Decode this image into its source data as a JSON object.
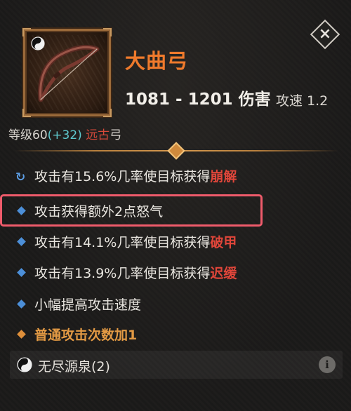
{
  "item": {
    "name": "大曲弓",
    "damage": "1081 - 1201 伤害",
    "speed": "攻速 1.2",
    "level_prefix": "等级60",
    "level_bonus": "(+32)",
    "level_type_colored": "远古",
    "level_type_suffix": "弓"
  },
  "close_label": "×",
  "attributes": [
    {
      "icon": "refresh-icon",
      "text": "攻击有15.6%几率使目标获得",
      "colored": "崩解"
    },
    {
      "icon": "blue-diamond-icon",
      "text": "攻击获得额外2点怒气",
      "colored": ""
    },
    {
      "icon": "blue-diamond-icon",
      "text": "攻击有14.1%几率使目标获得",
      "colored": "破甲"
    },
    {
      "icon": "blue-diamond-icon",
      "text": "攻击有13.9%几率使目标获得",
      "colored": "迟缓"
    },
    {
      "icon": "blue-diamond-icon",
      "text": "小幅提高攻击速度",
      "colored": ""
    },
    {
      "icon": "orange-diamond-icon",
      "text": "普通攻击次数加1",
      "colored": ""
    }
  ],
  "set": {
    "name": "无尽源泉(2)",
    "info_label": "i"
  },
  "colors": {
    "item_name": "#ef7a2c",
    "level_bonus": "#5fc9ce",
    "keyword_red": "#e0463a",
    "bullet_blue": "#4c8fd8",
    "bullet_orange": "#de8f3a",
    "highlight": "#ef5b6b",
    "frame": "#9b6a3a"
  }
}
